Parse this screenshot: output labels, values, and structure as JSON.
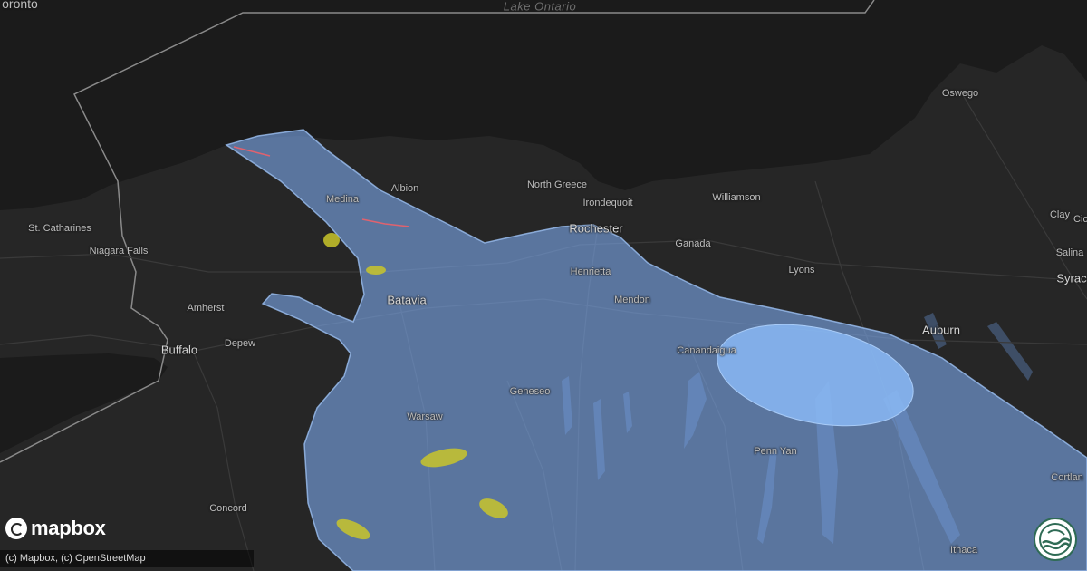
{
  "map": {
    "water_label": "Lake Ontario",
    "colors": {
      "land": "#262626",
      "water": "#1b1b1b",
      "border": "#8a8a8a",
      "warning_fill": "#7aa7e8",
      "warning_inner_fill": "#8ab8f5",
      "hail_marker": "#c9c52a",
      "wind_marker": "#e0626e"
    },
    "places": [
      {
        "id": "toronto",
        "name": "oronto"
      },
      {
        "id": "oswego",
        "name": "Oswego"
      },
      {
        "id": "north-greece",
        "name": "North Greece"
      },
      {
        "id": "albion",
        "name": "Albion"
      },
      {
        "id": "medina",
        "name": "Medina"
      },
      {
        "id": "irondequoit",
        "name": "Irondequoit"
      },
      {
        "id": "williamson",
        "name": "Williamson"
      },
      {
        "id": "st-catharines",
        "name": "St. Catharines"
      },
      {
        "id": "niagara-falls",
        "name": "Niagara Falls"
      },
      {
        "id": "rochester",
        "name": "Rochester"
      },
      {
        "id": "henrietta",
        "name": "Henrietta"
      },
      {
        "id": "ganada",
        "name": "Ganada"
      },
      {
        "id": "clay",
        "name": "Clay"
      },
      {
        "id": "cic",
        "name": "Cic"
      },
      {
        "id": "salina",
        "name": "Salina"
      },
      {
        "id": "syracuse",
        "name": "Syrac"
      },
      {
        "id": "lyons",
        "name": "Lyons"
      },
      {
        "id": "amherst",
        "name": "Amherst"
      },
      {
        "id": "batavia",
        "name": "Batavia"
      },
      {
        "id": "mendon",
        "name": "Mendon"
      },
      {
        "id": "auburn",
        "name": "Auburn"
      },
      {
        "id": "depew",
        "name": "Depew"
      },
      {
        "id": "buffalo",
        "name": "Buffalo"
      },
      {
        "id": "canandaigua",
        "name": "Canandaigua"
      },
      {
        "id": "geneseo",
        "name": "Geneseo"
      },
      {
        "id": "warsaw",
        "name": "Warsaw"
      },
      {
        "id": "penn-yan",
        "name": "Penn Yan"
      },
      {
        "id": "cortland",
        "name": "Cortlan"
      },
      {
        "id": "concord",
        "name": "Concord"
      },
      {
        "id": "ithaca",
        "name": "Ithaca"
      }
    ]
  },
  "branding": {
    "logo_text": "mapbox",
    "attribution": "(c) Mapbox, (c) OpenStreetMap"
  }
}
